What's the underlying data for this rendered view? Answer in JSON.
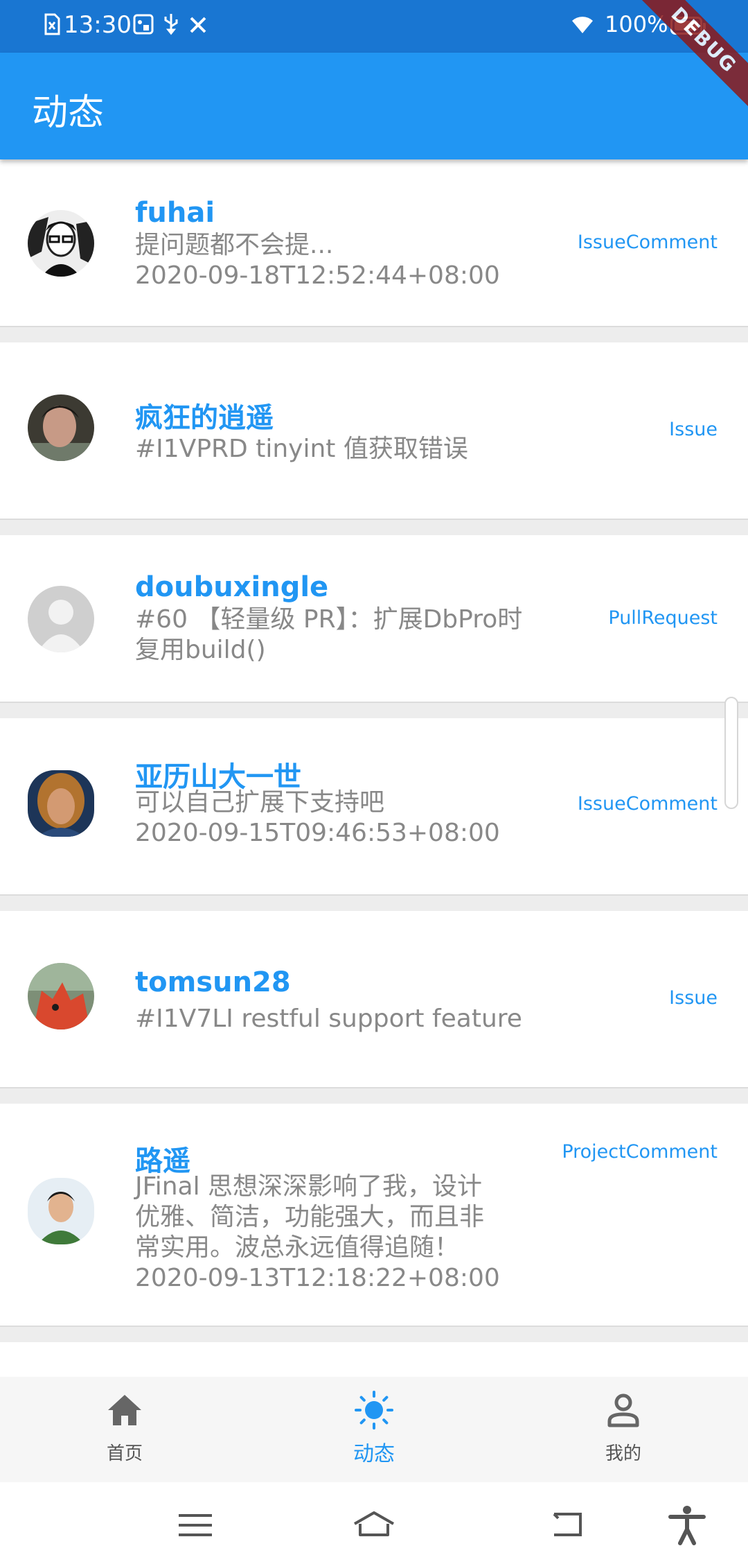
{
  "status_bar": {
    "time": "13:30",
    "battery": "100%",
    "battery_level": 1.0,
    "icons": [
      "sim-icon",
      "app-notification-icon",
      "usb-icon",
      "tools-icon",
      "wifi-icon",
      "battery-icon"
    ]
  },
  "app_bar": {
    "title": "动态"
  },
  "debug_banner": "DEBUG",
  "feed": {
    "items": [
      {
        "user": "fuhai",
        "lines": [
          "提问题都不会提...",
          "2020-09-18T12:52:44+08:00"
        ],
        "type": "IssueComment"
      },
      {
        "user": "疯狂的逍遥",
        "lines": [
          "#I1VPRD  tinyint  值获取错误"
        ],
        "type": "Issue"
      },
      {
        "user": "doubuxingle",
        "lines": [
          "#60 【轻量级 PR】：扩展DbPro时",
          "复用build()"
        ],
        "type": "PullRequest"
      },
      {
        "user": "亚历山大一世",
        "lines": [
          "可以自己扩展下支持吧",
          "2020-09-15T09:46:53+08:00"
        ],
        "type": "IssueComment"
      },
      {
        "user": "tomsun28",
        "lines": [
          "#I1V7LI  restful support  feature"
        ],
        "type": "Issue"
      },
      {
        "user": "路遥",
        "lines": [
          "JFinal 思想深深影响了我，设计",
          "优雅、简洁，功能强大，而且非",
          "常实用。波总永远值得追随！",
          "2020-09-13T12:18:22+08:00"
        ],
        "type": "ProjectComment"
      }
    ]
  },
  "bottom_nav": {
    "items": [
      {
        "label": "首页",
        "icon": "home-icon"
      },
      {
        "label": "动态",
        "icon": "sun-icon",
        "active": true
      },
      {
        "label": "我的",
        "icon": "person-icon"
      }
    ]
  },
  "colors": {
    "primary": "#2196f3",
    "status_bar": "#1976d2",
    "muted_text": "#888888"
  }
}
